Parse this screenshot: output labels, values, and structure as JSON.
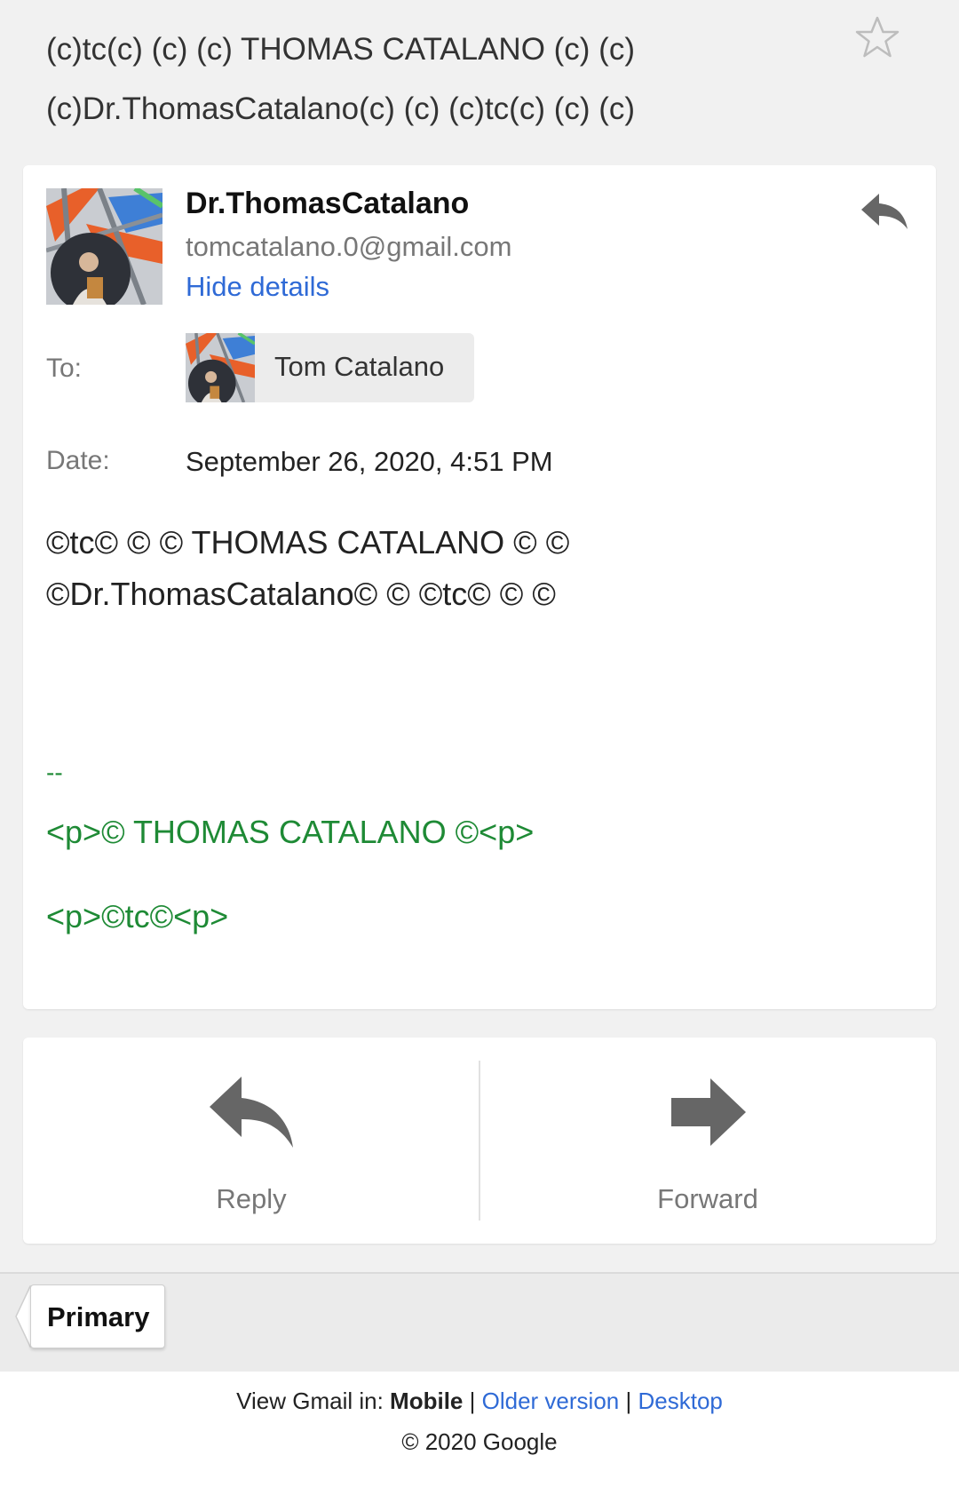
{
  "subject": "(c)tc(c) (c) (c) THOMAS CATALANO (c) (c) (c)Dr.ThomasCatalano(c) (c) (c)tc(c) (c) (c)",
  "sender": {
    "name": "Dr.ThomasCatalano",
    "email": "tomcatalano.0@gmail.com",
    "hide_details": "Hide details"
  },
  "details": {
    "to_label": "To:",
    "to_name": "Tom Catalano",
    "date_label": "Date:",
    "date_value": "September 26, 2020, 4:51 PM"
  },
  "body": {
    "line1": "©tc© © © THOMAS CATALANO © ©",
    "line2": "©Dr.ThomasCatalano© © ©tc© © ©",
    "sig_dash": "--",
    "sig_line1": "<p>© THOMAS CATALANO ©<p>",
    "sig_line2": "<p>©tc©<p>"
  },
  "actions": {
    "reply": "Reply",
    "forward": "Forward"
  },
  "tab": {
    "primary": "Primary"
  },
  "footer": {
    "view_prefix": "View Gmail in:",
    "mobile": "Mobile",
    "older": "Older version",
    "desktop": "Desktop",
    "sep": "|",
    "copyright": "© 2020 Google"
  },
  "colors": {
    "link": "#2f6ad6",
    "signature": "#1e8a35",
    "icon_gray": "#666666"
  }
}
